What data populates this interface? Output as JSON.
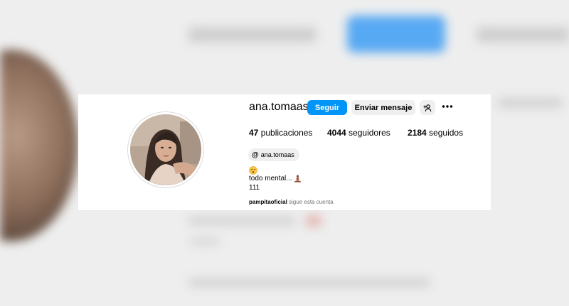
{
  "profile": {
    "username": "ana.tomaas",
    "follow_label": "Seguir",
    "message_label": "Enviar mensaje",
    "suggest_icon": "person-add-icon",
    "more_icon": "more-horizontal-icon"
  },
  "stats": {
    "posts_count": "47",
    "posts_label": "publicaciones",
    "followers_count": "4044",
    "followers_label": "seguidores",
    "following_count": "2184",
    "following_label": "seguidos"
  },
  "threads": {
    "icon": "threads-icon",
    "handle": "ana.tomaas"
  },
  "bio": {
    "emoji": "😮‍💨",
    "line1": "todo mental...",
    "line1_emoji": "🧘",
    "line2": "111"
  },
  "followed_by": {
    "name": "pampitaoficial",
    "text": "sigue esta cuenta"
  },
  "colors": {
    "accent": "#0095f6",
    "secondary_button": "#efefef",
    "muted_text": "#737373"
  }
}
